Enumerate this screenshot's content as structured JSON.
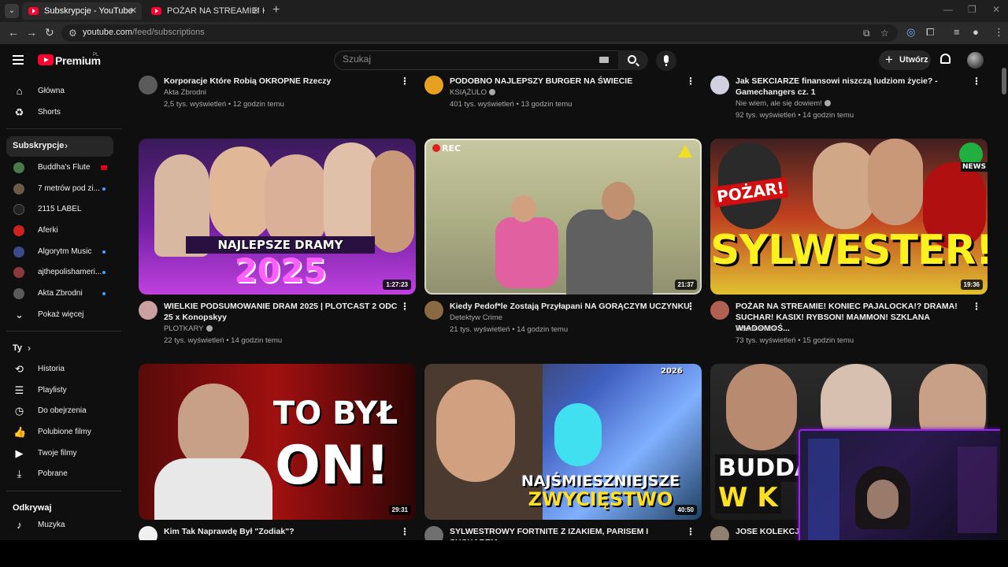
{
  "browser": {
    "tabs": [
      {
        "title": "Subskrypcje - YouTube",
        "active": true
      },
      {
        "title": "POŻAR NA STREAMIE! KONIEC",
        "active": false
      }
    ],
    "url_host": "youtube.com",
    "url_path": "/feed/subscriptions"
  },
  "topbar": {
    "logo_text": "Premium",
    "country": "PL",
    "search_placeholder": "Szukaj",
    "create_label": "Utwórz"
  },
  "sidebar": {
    "main": [
      {
        "label": "Główna",
        "icon": "home-icon"
      },
      {
        "label": "Shorts",
        "icon": "shorts-icon"
      }
    ],
    "subs_header": "Subskrypcje",
    "channels": [
      {
        "label": "Buddha's Flute",
        "color": "#4a7a4a",
        "badge": "flag"
      },
      {
        "label": "7 metrów pod zi...",
        "color": "#6a5a4a",
        "badge": "live"
      },
      {
        "label": "2115 LABEL",
        "color": "#222222",
        "badge": ""
      },
      {
        "label": "Aferki",
        "color": "#d02020",
        "badge": ""
      },
      {
        "label": "Algorytm Music",
        "color": "#3a4a8a",
        "badge": "live"
      },
      {
        "label": "ajthepolishameri...",
        "color": "#8a3a3a",
        "badge": "live"
      },
      {
        "label": "Akta Zbrodni",
        "color": "#5a5a5a",
        "badge": "live"
      }
    ],
    "show_more": "Pokaż więcej",
    "you_header": "Ty",
    "you_items": [
      {
        "label": "Historia",
        "icon": "history-icon"
      },
      {
        "label": "Playlisty",
        "icon": "playlists-icon"
      },
      {
        "label": "Do obejrzenia",
        "icon": "watch-later-icon"
      },
      {
        "label": "Polubione filmy",
        "icon": "thumbs-up-icon"
      },
      {
        "label": "Twoje filmy",
        "icon": "your-videos-icon"
      },
      {
        "label": "Pobrane",
        "icon": "download-icon"
      }
    ],
    "explore_header": "Odkrywaj",
    "explore_items": [
      {
        "label": "Muzyka",
        "icon": "music-icon"
      }
    ]
  },
  "videos": {
    "row0": [
      {
        "title": "Korporacje Które Robią OKROPNE Rzeczy",
        "channel": "Akta Zbrodni",
        "verified": false,
        "meta": "2,5 tys. wyświetleń • 12 godzin temu"
      },
      {
        "title": "PODOBNO NAJLEPSZY BURGER NA ŚWIECIE",
        "channel": "KSIĄŻULO",
        "verified": true,
        "meta": "401 tys. wyświetleń • 13 godzin temu"
      },
      {
        "title": "Jak SEKCIARZE finansowi niszczą ludziom życie? - Gamechangers cz. 1",
        "channel": "Nie wiem, ale się dowiem!",
        "verified": true,
        "meta": "92 tys. wyświetleń • 14 godzin temu"
      }
    ],
    "row1": [
      {
        "title": "WIELKIE PODSUMOWANIE DRAM 2025 | PLOTCAST 2 ODC 25 x Konopskyy",
        "channel": "PLOTKARY",
        "verified": true,
        "meta": "22 tys. wyświetleń • 14 godzin temu",
        "duration": "1:27:23",
        "overlay1": "NAJLEPSZE DRAMY",
        "overlay2": "2025"
      },
      {
        "title": "Kiedy Pedof*le Zostają Przyłapani NA GORĄCZYM UCZYNKU",
        "channel": "Detektyw Crime",
        "verified": false,
        "meta": "21 tys. wyświetleń • 14 godzin temu",
        "duration": "21:37",
        "overlay1": "REC"
      },
      {
        "title": "POŻAR NA STREAMIE! KONIEC PAJALOCKA!? DRAMA! SUCHAR! KASIX! RYBSON! MAMMON! SZKLANA WIADOMOŚ...",
        "channel": "SzklanaY2J",
        "verified": false,
        "meta": "73 tys. wyświetleń • 15 godzin temu",
        "duration": "19:36",
        "overlay1": "POŻAR!",
        "overlay2": "SYLWESTER!",
        "overlay3": "NEWS"
      }
    ],
    "row2": [
      {
        "title": "Kim Tak Naprawdę Był \"Zodiak\"?",
        "duration": "29:31",
        "overlay1": "TO BYŁ",
        "overlay2": "ON!"
      },
      {
        "title": "SYLWESTROWY FORTNITE Z IZAKIEM, PARISEM I SUCHAREM",
        "duration": "40:50",
        "overlay1": "NAJŚMIESZNIEJSZE",
        "overlay2": "ZWYCIĘSTWO",
        "overlay3": "2026"
      },
      {
        "title": "JOSE KOLEKCJ",
        "overlay1": "BUDDA",
        "overlay2": "W K"
      }
    ]
  }
}
